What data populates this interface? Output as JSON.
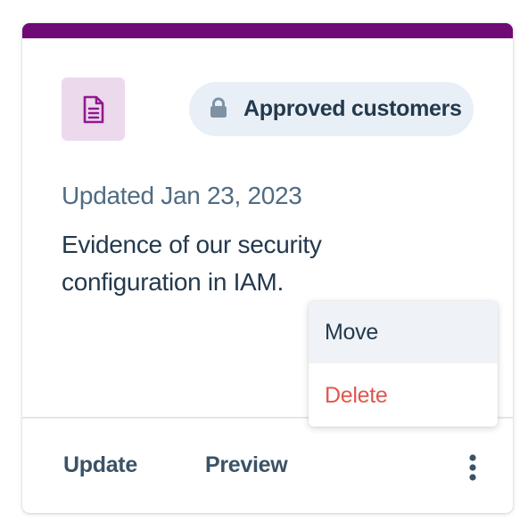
{
  "card": {
    "accent_color": "#6f0a75",
    "icon": "document-icon",
    "access_badge": {
      "icon": "lock-icon",
      "label": "Approved customers"
    },
    "updated_text": "Updated Jan 23, 2023",
    "description": "Evidence of our security configuration in IAM.",
    "actions": {
      "update_label": "Update",
      "preview_label": "Preview",
      "more_icon": "more-vertical-icon"
    }
  },
  "menu": {
    "items": [
      {
        "label": "Move",
        "color": "#23394d"
      },
      {
        "label": "Delete",
        "color": "#e0574e"
      }
    ]
  }
}
